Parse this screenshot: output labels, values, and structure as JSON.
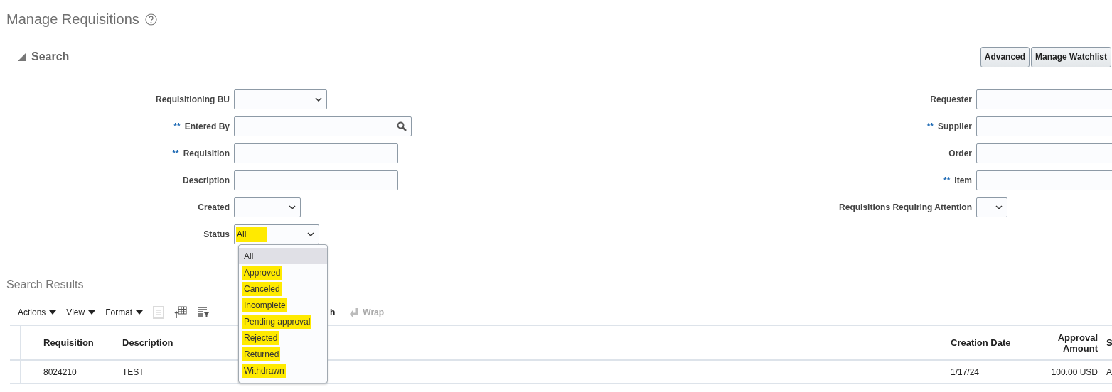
{
  "page_title": "Manage Requisitions",
  "search": {
    "title": "Search",
    "expanded": true,
    "buttons": [
      "Advanced",
      "Manage Watchlist"
    ],
    "left_fields": [
      {
        "label": "Requisitioning BU",
        "kind": "select",
        "required_any": false
      },
      {
        "label": "Entered By",
        "kind": "lookup",
        "required_any": true
      },
      {
        "label": "Requisition",
        "kind": "text",
        "required_any": true
      },
      {
        "label": "Description",
        "kind": "text",
        "required_any": false
      },
      {
        "label": "Created",
        "kind": "select",
        "required_any": false
      },
      {
        "label": "Status",
        "kind": "select",
        "required_any": false,
        "value": "All",
        "highlighted": true
      }
    ],
    "right_fields": [
      {
        "label": "Requester",
        "kind": "text",
        "required_any": false
      },
      {
        "label": "Supplier",
        "kind": "text",
        "required_any": true
      },
      {
        "label": "Order",
        "kind": "text",
        "required_any": false
      },
      {
        "label": "Item",
        "kind": "text",
        "required_any": true
      },
      {
        "label": "Requisitions Requiring Attention",
        "kind": "select",
        "required_any": false
      }
    ],
    "required_mark": "**"
  },
  "status_dropdown": {
    "options": [
      {
        "label": "All",
        "selected": true,
        "highlighted": false
      },
      {
        "label": "Approved",
        "selected": false,
        "highlighted": true
      },
      {
        "label": "Canceled",
        "selected": false,
        "highlighted": true
      },
      {
        "label": "Incomplete",
        "selected": false,
        "highlighted": true
      },
      {
        "label": "Pending approval",
        "selected": false,
        "highlighted": true
      },
      {
        "label": "Rejected",
        "selected": false,
        "highlighted": true
      },
      {
        "label": "Returned",
        "selected": false,
        "highlighted": true
      },
      {
        "label": "Withdrawn",
        "selected": false,
        "highlighted": true
      }
    ]
  },
  "results": {
    "title": "Search Results",
    "toolbar": [
      {
        "kind": "menu",
        "label": "Actions"
      },
      {
        "kind": "menu",
        "label": "View"
      },
      {
        "kind": "menu",
        "label": "Format"
      },
      {
        "kind": "icon",
        "disabled": true
      },
      {
        "kind": "icon",
        "disabled": false
      },
      {
        "kind": "icon",
        "disabled": false
      },
      {
        "kind": "button",
        "label": "h",
        "disabled": false
      },
      {
        "kind": "button",
        "label": "Wrap",
        "disabled": true
      }
    ],
    "table": {
      "columns": [
        "Requisition",
        "Description",
        "Creation Date",
        "Approval Amount",
        "S"
      ],
      "rows": [
        [
          "8024210",
          "TEST",
          "1/17/24",
          "100.00 USD",
          "A"
        ]
      ]
    }
  }
}
